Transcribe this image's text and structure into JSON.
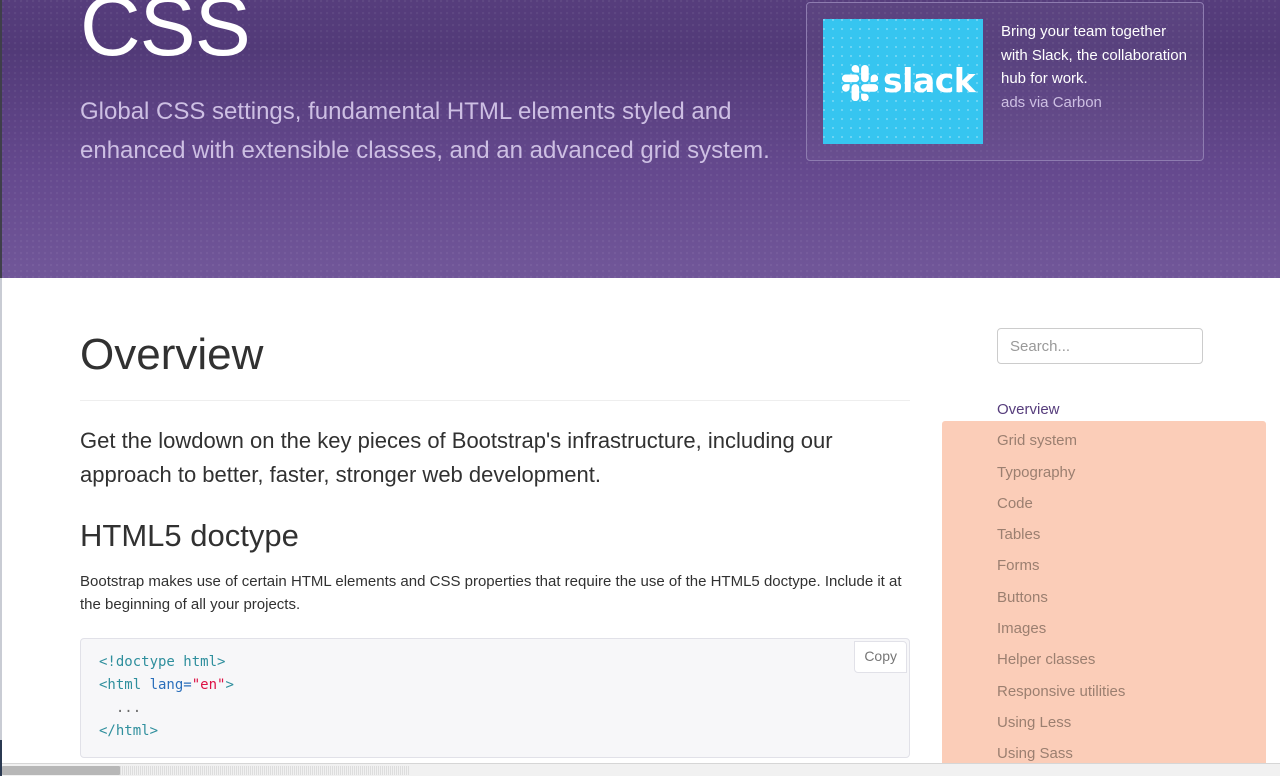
{
  "masthead": {
    "title": "CSS",
    "lead": "Global CSS settings, fundamental HTML elements styled and enhanced with extensible classes, and an advanced grid system."
  },
  "ad": {
    "brand": "slack",
    "logo_icon": "slack-hash-icon",
    "description": "Bring your team together with Slack, the collaboration hub for work.",
    "poweredby": "ads via Carbon",
    "brand_color": "#36c5f0"
  },
  "main": {
    "h1": "Overview",
    "lead": "Get the lowdown on the key pieces of Bootstrap's infrastructure, including our approach to better, faster, stronger web development.",
    "h2": "HTML5 doctype",
    "paragraph": "Bootstrap makes use of certain HTML elements and CSS properties that require the use of the HTML5 doctype. Include it at the beginning of all your projects.",
    "code_block": {
      "copy_label": "Copy",
      "lines": [
        [
          {
            "t": "<!doctype html>",
            "c": "tok-tag"
          }
        ],
        [
          {
            "t": "<html ",
            "c": "tok-tag"
          },
          {
            "t": "lang=",
            "c": "tok-attr"
          },
          {
            "t": "\"en\"",
            "c": "tok-str"
          },
          {
            "t": ">",
            "c": "tok-tag"
          }
        ],
        [
          {
            "t": "  ...",
            "c": "tok-plain"
          }
        ],
        [
          {
            "t": "</html>",
            "c": "tok-tag"
          }
        ]
      ]
    }
  },
  "sidebar": {
    "search": {
      "placeholder": "Search...",
      "value": ""
    },
    "items": [
      {
        "label": "Overview",
        "highlighted": false
      },
      {
        "label": "Grid system",
        "highlighted": true
      },
      {
        "label": "Typography",
        "highlighted": true
      },
      {
        "label": "Code",
        "highlighted": true
      },
      {
        "label": "Tables",
        "highlighted": true
      },
      {
        "label": "Forms",
        "highlighted": true
      },
      {
        "label": "Buttons",
        "highlighted": true
      },
      {
        "label": "Images",
        "highlighted": true
      },
      {
        "label": "Helper classes",
        "highlighted": true
      },
      {
        "label": "Responsive utilities",
        "highlighted": true
      },
      {
        "label": "Using Less",
        "highlighted": true
      },
      {
        "label": "Using Sass",
        "highlighted": true
      }
    ],
    "highlight_color": "#fbcdb8"
  },
  "colors": {
    "masthead_top": "#563d7c",
    "masthead_bottom": "#715799",
    "lead_text": "#cdbfe3",
    "code_bg": "#f7f7f9"
  }
}
